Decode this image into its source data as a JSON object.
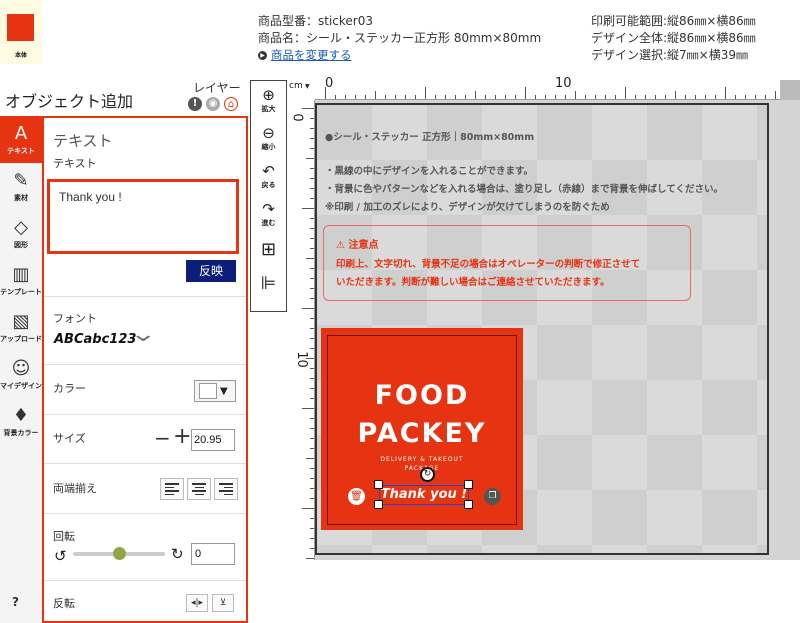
{
  "header": {
    "thumb_label": "本体",
    "model": "商品型番：sticker03",
    "product": "商品名：シール・ステッカー正方形 80mm×80mm",
    "change_link": "商品を変更する",
    "print_area": "印刷可能範囲:縦86㎜×横86㎜",
    "design_total": "デザイン全体:縦86㎜×横86㎜",
    "design_selected": "デザイン選択:縦7㎜×横39㎜"
  },
  "panel": {
    "title": "オブジェクト追加",
    "layer_label": "レイヤー",
    "rail": [
      "テキスト",
      "素材",
      "図形",
      "テンプレート",
      "アップロード",
      "マイデザイン",
      "背景カラー"
    ],
    "help": "?"
  },
  "text_panel": {
    "title": "テキスト",
    "sub": "テキスト",
    "text_value": "Thank you !",
    "apply": "反映",
    "font_label": "フォント",
    "font_sample": "ABCabc123",
    "color_label": "カラー",
    "size_label": "サイズ",
    "size_value": "20.95",
    "align_label": "両端揃え",
    "rotate_label": "回転",
    "rotate_value": "0",
    "flip_label": "反転"
  },
  "tools": [
    "拡大",
    "縮小",
    "戻る",
    "進む"
  ],
  "ruler": {
    "unit": "cm",
    "h_marks": [
      "0",
      "10"
    ],
    "v_marks": [
      "0",
      "10"
    ]
  },
  "canvas": {
    "heading": "●シール・ステッカー 正方形｜80mm×80mm",
    "bullet1": "・黒線の中にデザインを入れることができます。",
    "bullet2": "・背景に色やパターンなどを入れる場合は、塗り足し（赤線）まで背景を伸ばしてください。",
    "bullet3": "※印刷 / 加工のズレにより、デザインが欠けてしまうのを防ぐため",
    "caution_title": "注意点",
    "caution_line1": "印刷上、文字切れ、背景不足の場合はオペレーターの判断で修正させて",
    "caution_line2": "いただきます。判断が難しい場合はご連絡させていただきます。"
  },
  "sticker": {
    "line1": "FOOD",
    "line2": "PACKEY",
    "tagline": "DELIVERY & TAKEOUT",
    "tagline2": "PACKAGE",
    "selected_text": "Thank you !"
  },
  "colors": {
    "accent": "#e63312",
    "apply_button": "#0c1e7a",
    "link": "#1a5bb8"
  },
  "rotation_slider": {
    "value_fraction": 0.5
  }
}
